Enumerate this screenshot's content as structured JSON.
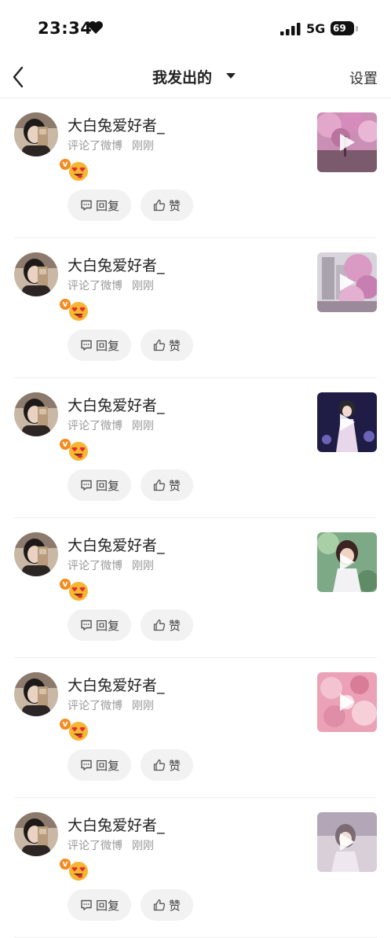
{
  "status_bar": {
    "time": "23:34",
    "network": "5G",
    "battery": "69"
  },
  "nav": {
    "title": "我发出的",
    "settings": "设置"
  },
  "items": [
    {
      "username": "大白兔爱好者_",
      "action": "评论了微博",
      "time": "刚刚",
      "reply_label": "回复",
      "like_label": "赞",
      "thumb": "pink-blossom-tree"
    },
    {
      "username": "大白兔爱好者_",
      "action": "评论了微博",
      "time": "刚刚",
      "reply_label": "回复",
      "like_label": "赞",
      "thumb": "city-blossom"
    },
    {
      "username": "大白兔爱好者_",
      "action": "评论了微博",
      "time": "刚刚",
      "reply_label": "回复",
      "like_label": "赞",
      "thumb": "stage-performer"
    },
    {
      "username": "大白兔爱好者_",
      "action": "评论了微博",
      "time": "刚刚",
      "reply_label": "回复",
      "like_label": "赞",
      "thumb": "portrait-garden"
    },
    {
      "username": "大白兔爱好者_",
      "action": "评论了微博",
      "time": "刚刚",
      "reply_label": "回复",
      "like_label": "赞",
      "thumb": "pink-flowers"
    },
    {
      "username": "大白兔爱好者_",
      "action": "评论了微博",
      "time": "刚刚",
      "reply_label": "回复",
      "like_label": "赞",
      "thumb": "soft-portrait"
    }
  ],
  "colors": {
    "verified_badge": "#f58b1f",
    "button_bg": "#f2f2f2",
    "meta_text": "#999999"
  }
}
